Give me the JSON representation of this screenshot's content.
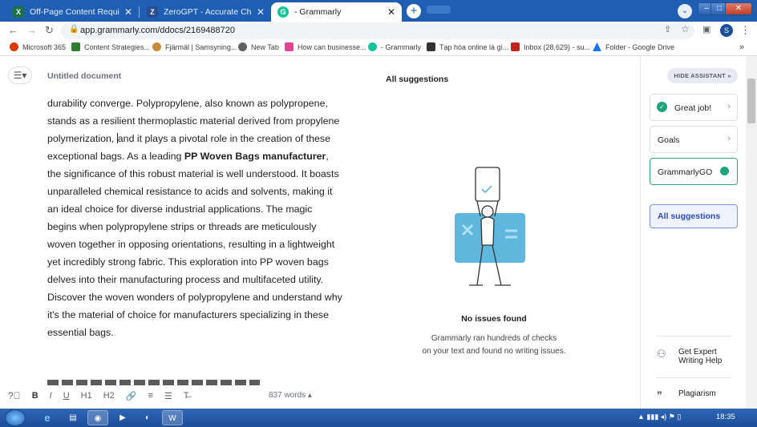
{
  "browser": {
    "tabs": [
      {
        "title": "Off-Page Content Requirement S",
        "icon": "excel-icon",
        "color": "#1e7145"
      },
      {
        "title": "ZeroGPT - Accurate Chat GPT, GI",
        "icon": "zerogpt-icon",
        "color": "#2a4d8f"
      },
      {
        "title": "- Grammarly",
        "icon": "grammarly-icon",
        "color": "#15c39a",
        "active": true
      }
    ],
    "tab_close": "✕",
    "new_tab": "+",
    "url": "app.grammarly.com/ddocs/2169488720",
    "profile_initial": "S",
    "bookmarks": [
      {
        "label": "Microsoft 365",
        "color": "#d83b01"
      },
      {
        "label": "Content Strategies...",
        "color": "#2e7d32"
      },
      {
        "label": "Fjärmäl | Samsyning...",
        "color": "#c98a3a"
      },
      {
        "label": "New Tab",
        "color": "#5f6368"
      },
      {
        "label": "How can businesse...",
        "color": "#e84393"
      },
      {
        "label": "- Grammarly",
        "color": "#15c39a"
      },
      {
        "label": "Tạp hóa online là gì...",
        "color": "#333333"
      },
      {
        "label": "Inbox (28,629) - su...",
        "color": "#c5221f"
      },
      {
        "label": "Folder - Google Drive",
        "color": "#1a73e8"
      }
    ]
  },
  "document": {
    "title": "Untitled document",
    "paragraph": {
      "p1": "durability converge. Polypropylene, also known as polypropene, stands as a resilient thermoplastic material derived from propylene polymerization, ",
      "p2": "and it plays a pivotal role in the creation of these exceptional bags. As a leading ",
      "bold": "PP Woven Bags manufacturer",
      "p3": ", the significance of this robust material is well understood. It boasts unparalleled chemical resistance to acids and solvents, making it an ideal choice for diverse industrial applications. The magic begins when polypropylene strips or threads are meticulously woven together in opposing orientations, resulting in a lightweight yet incredibly strong fabric. This exploration into PP woven bags delves into their manufacturing process and multifaceted utility. Discover the woven wonders of polypropylene and understand why it's the material of choice for manufacturers specializing in these essential bags."
    },
    "word_count": "837 words",
    "word_count_caret": "▴",
    "format_tools": [
      "B",
      "I",
      "U",
      "H1",
      "H2",
      "🔗",
      "≡",
      "☰",
      "T̶"
    ]
  },
  "assistant": {
    "heading": "All suggestions",
    "empty_title": "No issues found",
    "empty_line1": "Grammarly ran hundreds of checks",
    "empty_line2": "on your text and found no writing issues.",
    "hide_label": "HIDE ASSISTANT",
    "hide_icon": "»",
    "great_job": "Great job!",
    "goals": "Goals",
    "grammarly_go": "GrammarlyGO",
    "all_suggestions": "All suggestions",
    "expert_help_1": "Get Expert",
    "expert_help_2": "Writing Help",
    "plagiarism": "Plagiarism",
    "chevron": "›"
  },
  "taskbar": {
    "time": "18:35",
    "tray_icons": "▲  ▮▮▮  ◂)  ⚑  ▯"
  },
  "colors": {
    "grammarly_green": "#15c39a",
    "accent_blue": "#2a4bbd",
    "illustration_blue": "#5fb7dd"
  }
}
